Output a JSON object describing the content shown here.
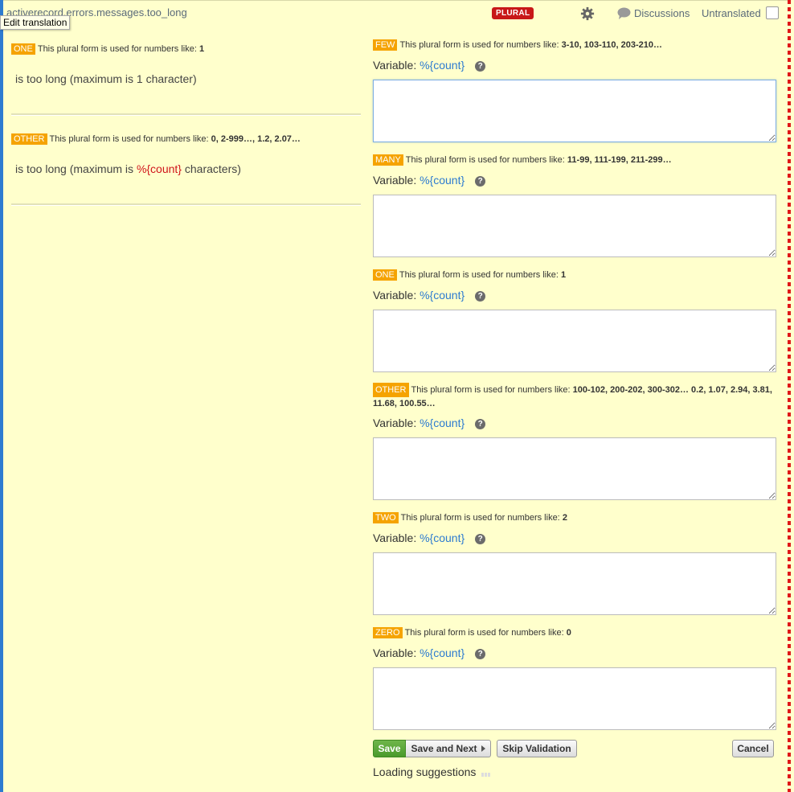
{
  "header": {
    "key": "activerecord.errors.messages.too_long",
    "tooltip": "Edit translation",
    "plural_badge": "PLURAL",
    "discussions": "Discussions",
    "untranslated": "Untranslated"
  },
  "source": [
    {
      "tag": "ONE",
      "desc": "This plural form is used for numbers like:",
      "examples": "1",
      "text_before": "is too long (maximum is 1 character)",
      "variable": "",
      "text_after": ""
    },
    {
      "tag": "OTHER",
      "desc": "This plural form is used for numbers like:",
      "examples": "0, 2-999…, 1.2, 2.07…",
      "text_before": "is too long (maximum is ",
      "variable": "%{count}",
      "text_after": " characters)"
    }
  ],
  "targets": [
    {
      "tag": "FEW",
      "desc": "This plural form is used for numbers like:",
      "examples": "3-10, 103-110, 203-210…",
      "variable_label": "Variable:",
      "variable": "%{count}",
      "value": ""
    },
    {
      "tag": "MANY",
      "desc": "This plural form is used for numbers like:",
      "examples": "11-99, 111-199, 211-299…",
      "variable_label": "Variable:",
      "variable": "%{count}",
      "value": ""
    },
    {
      "tag": "ONE",
      "desc": "This plural form is used for numbers like:",
      "examples": "1",
      "variable_label": "Variable:",
      "variable": "%{count}",
      "value": ""
    },
    {
      "tag": "OTHER",
      "desc": "This plural form is used for numbers like:",
      "examples": "100-102, 200-202, 300-302… 0.2, 1.07, 2.94, 3.81, 11.68, 100.55…",
      "variable_label": "Variable:",
      "variable": "%{count}",
      "value": ""
    },
    {
      "tag": "TWO",
      "desc": "This plural form is used for numbers like:",
      "examples": "2",
      "variable_label": "Variable:",
      "variable": "%{count}",
      "value": ""
    },
    {
      "tag": "ZERO",
      "desc": "This plural form is used for numbers like:",
      "examples": "0",
      "variable_label": "Variable:",
      "variable": "%{count}",
      "value": ""
    }
  ],
  "help_glyph": "?",
  "buttons": {
    "save": "Save",
    "save_next": "Save and Next",
    "skip_validation": "Skip Validation",
    "cancel": "Cancel"
  },
  "loading": "Loading suggestions",
  "colors": {
    "background": "#ffffcc",
    "tag": "#f5a300",
    "plural_badge": "#c81818",
    "variable": "#2d7bd0",
    "source_variable": "#d0151b",
    "save_button": "#4a9a2c"
  },
  "icons": [
    "gear-icon",
    "speech-bubble-icon",
    "help-icon",
    "arrow-right-icon",
    "resize-handle-icon"
  ]
}
